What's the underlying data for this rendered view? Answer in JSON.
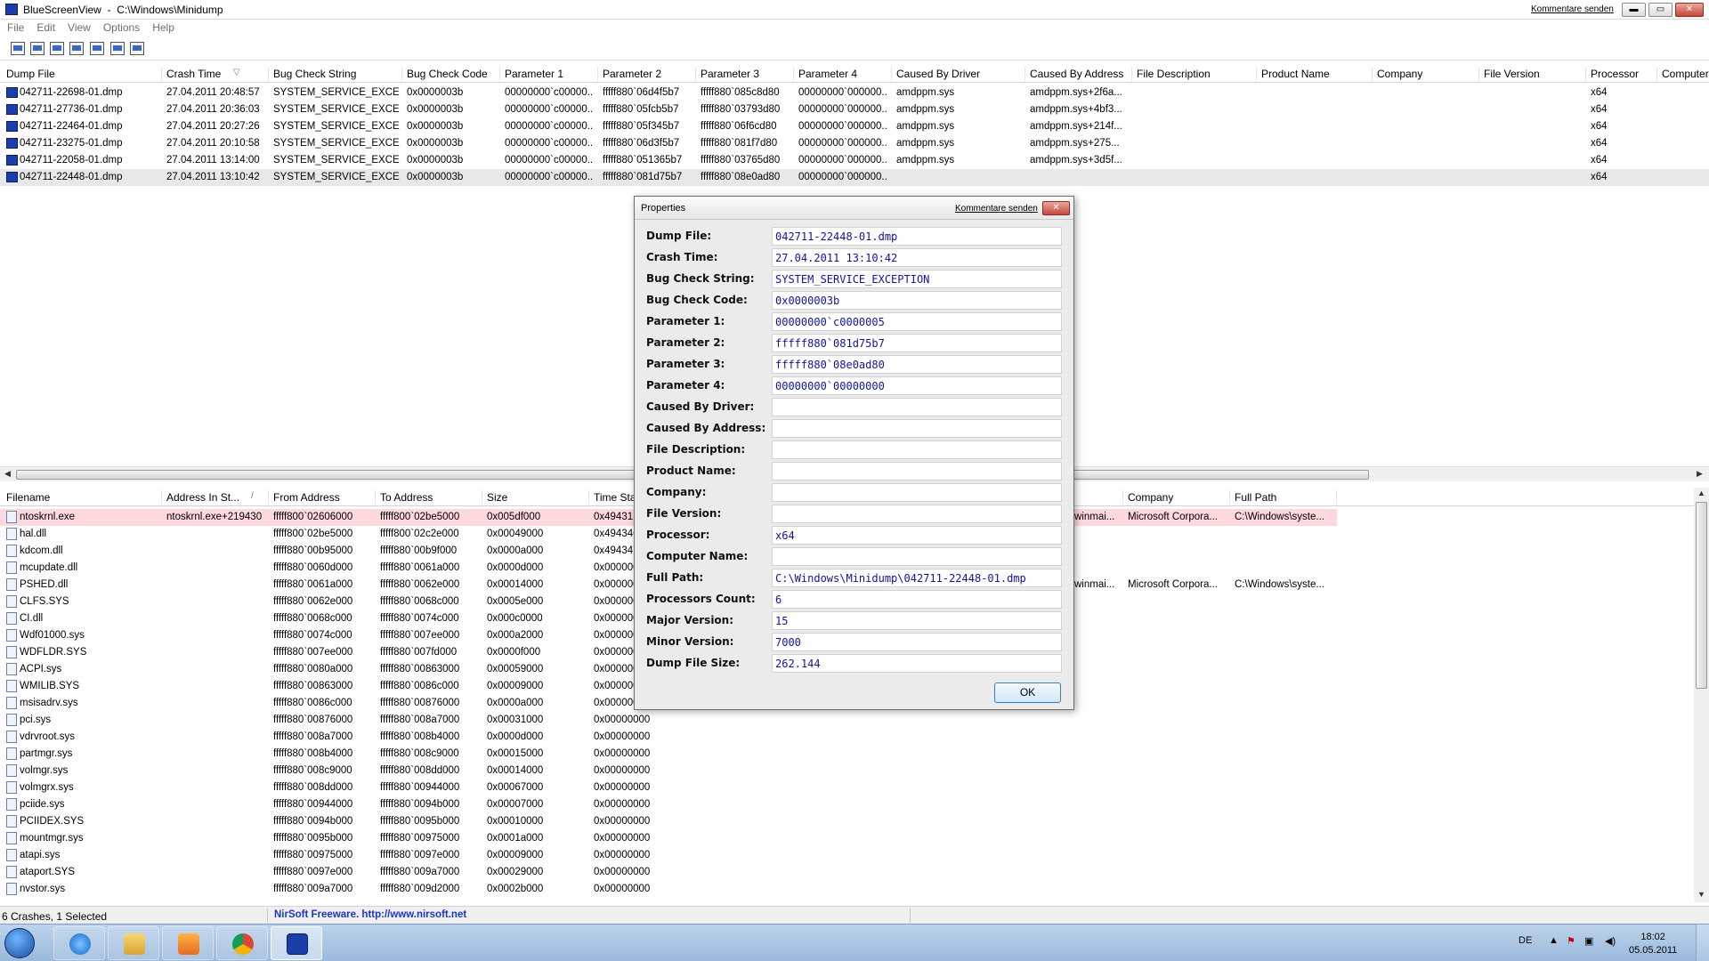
{
  "window": {
    "app_name": "BlueScreenView",
    "path": "C:\\Windows\\Minidump",
    "kommentare": "Kommentare senden",
    "btn_min": "▬",
    "btn_max": "▭",
    "btn_close": "✕"
  },
  "menu": [
    "File",
    "Edit",
    "View",
    "Options",
    "Help"
  ],
  "toolbar_icons": [
    "properties-icon",
    "save-icon",
    "refresh-icon",
    "copy-icon",
    "report-icon",
    "search-icon",
    "exit-icon"
  ],
  "upper_columns": [
    "Dump File",
    "Crash Time",
    "Bug Check String",
    "Bug Check Code",
    "Parameter 1",
    "Parameter 2",
    "Parameter 3",
    "Parameter 4",
    "Caused By Driver",
    "Caused By Address",
    "File Description",
    "Product Name",
    "Company",
    "File Version",
    "Processor",
    "Computer"
  ],
  "sort_indicator": "▽",
  "crashes": [
    [
      "042711-22698-01.dmp",
      "27.04.2011 20:48:57",
      "SYSTEM_SERVICE_EXCE...",
      "0x0000003b",
      "00000000`c00000...",
      "fffff880`06d4f5b7",
      "fffff880`085c8d80",
      "00000000`000000...",
      "amdppm.sys",
      "amdppm.sys+2f6a...",
      "x64"
    ],
    [
      "042711-27736-01.dmp",
      "27.04.2011 20:36:03",
      "SYSTEM_SERVICE_EXCE...",
      "0x0000003b",
      "00000000`c00000...",
      "fffff880`05fcb5b7",
      "fffff880`03793d80",
      "00000000`000000...",
      "amdppm.sys",
      "amdppm.sys+4bf3...",
      "x64"
    ],
    [
      "042711-22464-01.dmp",
      "27.04.2011 20:27:26",
      "SYSTEM_SERVICE_EXCE...",
      "0x0000003b",
      "00000000`c00000...",
      "fffff880`05f345b7",
      "fffff880`06f6cd80",
      "00000000`000000...",
      "amdppm.sys",
      "amdppm.sys+214f...",
      "x64"
    ],
    [
      "042711-23275-01.dmp",
      "27.04.2011 20:10:58",
      "SYSTEM_SERVICE_EXCE...",
      "0x0000003b",
      "00000000`c00000...",
      "fffff880`06d3f5b7",
      "fffff880`081f7d80",
      "00000000`000000...",
      "amdppm.sys",
      "amdppm.sys+275...",
      "x64"
    ],
    [
      "042711-22058-01.dmp",
      "27.04.2011 13:14:00",
      "SYSTEM_SERVICE_EXCE...",
      "0x0000003b",
      "00000000`c00000...",
      "fffff880`051365b7",
      "fffff880`03765d80",
      "00000000`000000...",
      "amdppm.sys",
      "amdppm.sys+3d5f...",
      "x64"
    ],
    [
      "042711-22448-01.dmp",
      "27.04.2011 13:10:42",
      "SYSTEM_SERVICE_EXCE...",
      "0x0000003b",
      "00000000`c00000...",
      "fffff880`081d75b7",
      "fffff880`08e0ad80",
      "00000000`000000...",
      "",
      "",
      "x64"
    ]
  ],
  "lower_columns": [
    "Filename",
    "Address In St...",
    "From Address",
    "To Address",
    "Size",
    "Time Sta",
    "Company",
    "Full Path"
  ],
  "sort_indicator_lower": "/",
  "drivers": [
    [
      "ntoskrnl.exe",
      "ntoskrnl.exe+219430",
      "fffff800`02606000",
      "fffff800`02be5000",
      "0x005df000",
      "0x49431",
      "winmai...",
      "Microsoft Corpora...",
      "C:\\Windows\\syste..."
    ],
    [
      "hal.dll",
      "",
      "fffff800`02be5000",
      "fffff800`02c2e000",
      "0x00049000",
      "0x494346",
      "",
      "",
      ""
    ],
    [
      "kdcom.dll",
      "",
      "fffff880`00b95000",
      "fffff880`00b9f000",
      "0x0000a000",
      "0x494347",
      "",
      "",
      ""
    ],
    [
      "mcupdate.dll",
      "",
      "fffff880`0060d000",
      "fffff880`0061a000",
      "0x0000d000",
      "0x000000",
      "",
      "",
      ""
    ],
    [
      "PSHED.dll",
      "",
      "fffff880`0061a000",
      "fffff880`0062e000",
      "0x00014000",
      "0x000000",
      "winmai...",
      "Microsoft Corpora...",
      "C:\\Windows\\syste..."
    ],
    [
      "CLFS.SYS",
      "",
      "fffff880`0062e000",
      "fffff880`0068c000",
      "0x0005e000",
      "0x000000",
      "",
      "",
      ""
    ],
    [
      "CI.dll",
      "",
      "fffff880`0068c000",
      "fffff880`0074c000",
      "0x000c0000",
      "0x000000",
      "",
      "",
      ""
    ],
    [
      "Wdf01000.sys",
      "",
      "fffff880`0074c000",
      "fffff880`007ee000",
      "0x000a2000",
      "0x000000",
      "",
      "",
      ""
    ],
    [
      "WDFLDR.SYS",
      "",
      "fffff880`007ee000",
      "fffff880`007fd000",
      "0x0000f000",
      "0x000000",
      "",
      "",
      ""
    ],
    [
      "ACPI.sys",
      "",
      "fffff880`0080a000",
      "fffff880`00863000",
      "0x00059000",
      "0x000000",
      "",
      "",
      ""
    ],
    [
      "WMILIB.SYS",
      "",
      "fffff880`00863000",
      "fffff880`0086c000",
      "0x00009000",
      "0x000000",
      "",
      "",
      ""
    ],
    [
      "msisadrv.sys",
      "",
      "fffff880`0086c000",
      "fffff880`00876000",
      "0x0000a000",
      "0x000000",
      "",
      "",
      ""
    ],
    [
      "pci.sys",
      "",
      "fffff880`00876000",
      "fffff880`008a7000",
      "0x00031000",
      "0x00000000",
      "",
      "",
      ""
    ],
    [
      "vdrvroot.sys",
      "",
      "fffff880`008a7000",
      "fffff880`008b4000",
      "0x0000d000",
      "0x00000000",
      "",
      "",
      ""
    ],
    [
      "partmgr.sys",
      "",
      "fffff880`008b4000",
      "fffff880`008c9000",
      "0x00015000",
      "0x00000000",
      "",
      "",
      ""
    ],
    [
      "volmgr.sys",
      "",
      "fffff880`008c9000",
      "fffff880`008dd000",
      "0x00014000",
      "0x00000000",
      "",
      "",
      ""
    ],
    [
      "volmgrx.sys",
      "",
      "fffff880`008dd000",
      "fffff880`00944000",
      "0x00067000",
      "0x00000000",
      "",
      "",
      ""
    ],
    [
      "pciide.sys",
      "",
      "fffff880`00944000",
      "fffff880`0094b000",
      "0x00007000",
      "0x00000000",
      "",
      "",
      ""
    ],
    [
      "PCIIDEX.SYS",
      "",
      "fffff880`0094b000",
      "fffff880`0095b000",
      "0x00010000",
      "0x00000000",
      "",
      "",
      ""
    ],
    [
      "mountmgr.sys",
      "",
      "fffff880`0095b000",
      "fffff880`00975000",
      "0x0001a000",
      "0x00000000",
      "",
      "",
      ""
    ],
    [
      "atapi.sys",
      "",
      "fffff880`00975000",
      "fffff880`0097e000",
      "0x00009000",
      "0x00000000",
      "",
      "",
      ""
    ],
    [
      "ataport.SYS",
      "",
      "fffff880`0097e000",
      "fffff880`009a7000",
      "0x00029000",
      "0x00000000",
      "",
      "",
      ""
    ],
    [
      "nvstor.sys",
      "",
      "fffff880`009a7000",
      "fffff880`009d2000",
      "0x0002b000",
      "0x00000000",
      "",
      "",
      ""
    ]
  ],
  "status": {
    "left": "6 Crashes, 1 Selected",
    "link": "NirSoft Freeware.  http://www.nirsoft.net"
  },
  "dialog": {
    "title": "Properties",
    "kommentare": "Kommentare senden",
    "close": "✕",
    "ok": "OK",
    "fields": [
      {
        "label": "Dump File:",
        "value": "042711-22448-01.dmp"
      },
      {
        "label": "Crash Time:",
        "value": "27.04.2011 13:10:42"
      },
      {
        "label": "Bug Check String:",
        "value": "SYSTEM_SERVICE_EXCEPTION"
      },
      {
        "label": "Bug Check Code:",
        "value": "0x0000003b"
      },
      {
        "label": "Parameter 1:",
        "value": "00000000`c0000005"
      },
      {
        "label": "Parameter 2:",
        "value": "fffff880`081d75b7"
      },
      {
        "label": "Parameter 3:",
        "value": "fffff880`08e0ad80"
      },
      {
        "label": "Parameter 4:",
        "value": "00000000`00000000"
      },
      {
        "label": "Caused By Driver:",
        "value": ""
      },
      {
        "label": "Caused By Address:",
        "value": ""
      },
      {
        "label": "File Description:",
        "value": ""
      },
      {
        "label": "Product Name:",
        "value": ""
      },
      {
        "label": "Company:",
        "value": ""
      },
      {
        "label": "File Version:",
        "value": ""
      },
      {
        "label": "Processor:",
        "value": "x64"
      },
      {
        "label": "Computer Name:",
        "value": ""
      },
      {
        "label": "Full Path:",
        "value": "C:\\Windows\\Minidump\\042711-22448-01.dmp"
      },
      {
        "label": "Processors Count:",
        "value": "6"
      },
      {
        "label": "Major Version:",
        "value": "15"
      },
      {
        "label": "Minor Version:",
        "value": "7000"
      },
      {
        "label": "Dump File Size:",
        "value": "262.144"
      }
    ]
  },
  "taskbar": {
    "apps": [
      "internet-explorer-icon",
      "explorer-icon",
      "media-player-icon",
      "chrome-icon",
      "bluescreenview-icon"
    ],
    "lang": "DE",
    "time": "18:02",
    "date": "05.05.2011"
  },
  "colors": {
    "selected_row": "#e8e8e8",
    "highlight_row": "#fdd8dc",
    "dialog_value_text": "#13139c",
    "link": "#1a36c7"
  }
}
